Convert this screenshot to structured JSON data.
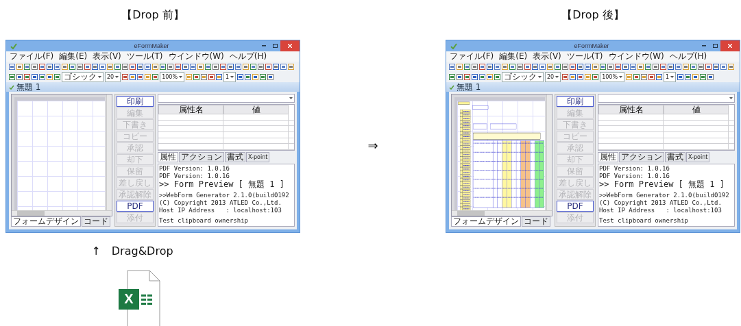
{
  "headings": [
    {
      "text": "【Drop 前】"
    },
    {
      "text": "【Drop 後】"
    }
  ],
  "arrow": "⇒",
  "drag_caption": "↑　Drag&Drop",
  "excel_icon": {
    "letter": "X"
  },
  "windows": [
    {
      "title": "eFormMaker",
      "menu": [
        "ファイル(F)",
        "編集(E)",
        "表示(V)",
        "ツール(T)",
        "ウインドウ(W)",
        "ヘルプ(H)"
      ],
      "font_combo": "ゴシック",
      "size_combo": "20",
      "zoom_combo": "100%",
      "page_combo": "1",
      "doc_title": "無題 1",
      "form_filled": false,
      "action_buttons": [
        {
          "label": "印刷",
          "disabled": false
        },
        {
          "label": "編集",
          "disabled": true
        },
        {
          "label": "下書き",
          "disabled": true
        },
        {
          "label": "コピー",
          "disabled": true
        },
        {
          "label": "承認",
          "disabled": true
        },
        {
          "label": "却下",
          "disabled": true
        },
        {
          "label": "保留",
          "disabled": true
        },
        {
          "label": "差し戻し",
          "disabled": true
        },
        {
          "label": "承認解除",
          "disabled": true
        },
        {
          "label": "PDF",
          "disabled": false
        },
        {
          "label": "添付",
          "disabled": true
        }
      ],
      "prop_columns": [
        "属性名",
        "値"
      ],
      "panel_tabs": [
        {
          "label": "属性",
          "selected": true
        },
        {
          "label": "アクション",
          "selected": false
        },
        {
          "label": "書式",
          "selected": false
        },
        {
          "label": "X-point",
          "selected": false
        }
      ],
      "log": [
        [
          "PDF Version: 1.0.16",
          "PDF Version: 1.0.16",
          ">> Form Preview [ 無題 1 ]"
        ],
        [
          ">>WebForm Generator 2.1.0(build0192",
          "(C) Copyright 2013 ATLED Co.,Ltd.",
          "Host IP Address   : localhost:103"
        ],
        [
          "Test clipboard ownership"
        ]
      ],
      "bottom_tabs": [
        {
          "label": "フォームデザイン",
          "selected": true
        },
        {
          "label": "コード",
          "selected": false
        }
      ]
    },
    {
      "title": "eFormMaker",
      "menu": [
        "ファイル(F)",
        "編集(E)",
        "表示(V)",
        "ツール(T)",
        "ウインドウ(W)",
        "ヘルプ(H)"
      ],
      "font_combo": "ゴシック",
      "size_combo": "20",
      "zoom_combo": "100%",
      "page_combo": "1",
      "doc_title": "無題 1",
      "form_filled": true,
      "action_buttons": [
        {
          "label": "印刷",
          "disabled": false
        },
        {
          "label": "編集",
          "disabled": true
        },
        {
          "label": "下書き",
          "disabled": true
        },
        {
          "label": "コピー",
          "disabled": true
        },
        {
          "label": "承認",
          "disabled": true
        },
        {
          "label": "却下",
          "disabled": true
        },
        {
          "label": "保留",
          "disabled": true
        },
        {
          "label": "差し戻し",
          "disabled": true
        },
        {
          "label": "承認解除",
          "disabled": true
        },
        {
          "label": "PDF",
          "disabled": false
        },
        {
          "label": "添付",
          "disabled": true
        }
      ],
      "prop_columns": [
        "属性名",
        "値"
      ],
      "panel_tabs": [
        {
          "label": "属性",
          "selected": true
        },
        {
          "label": "アクション",
          "selected": false
        },
        {
          "label": "書式",
          "selected": false
        },
        {
          "label": "X-point",
          "selected": false
        }
      ],
      "log": [
        [
          "PDF Version: 1.0.16",
          "PDF Version: 1.0.16",
          ">> Form Preview [ 無題 1 ]"
        ],
        [
          ">>WebForm Generator 2.1.0(build0192",
          "(C) Copyright 2013 ATLED Co.,Ltd.",
          "Host IP Address   : localhost:103"
        ],
        [
          "Test clipboard ownership"
        ]
      ],
      "bottom_tabs": [
        {
          "label": "フォームデザイン",
          "selected": true
        },
        {
          "label": "コード",
          "selected": false
        }
      ]
    }
  ]
}
